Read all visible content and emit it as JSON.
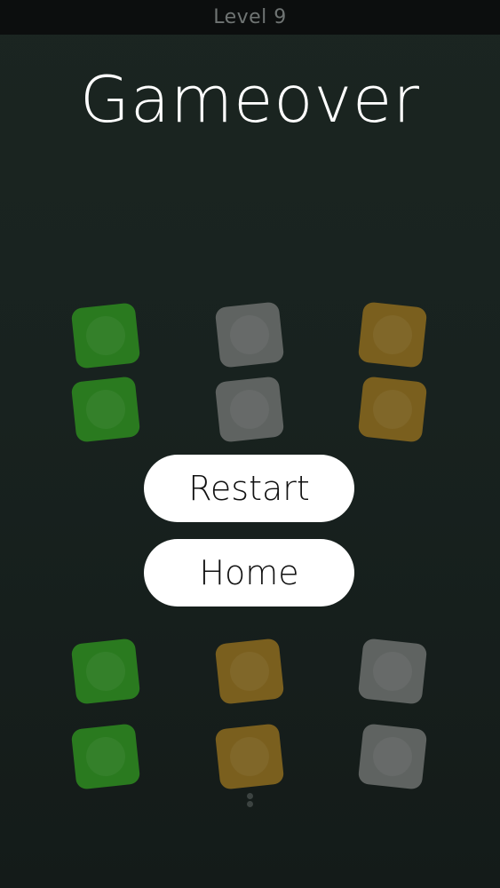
{
  "status": {
    "level_label": "Level 9"
  },
  "title": "Gameover",
  "board": {
    "tiles": [
      {
        "color": "green"
      },
      {
        "color": "gray"
      },
      {
        "color": "gold"
      },
      {
        "color": "green"
      },
      {
        "color": "gray"
      },
      {
        "color": "gold"
      },
      {
        "color": "green"
      },
      {
        "color": "gold"
      },
      {
        "color": "gray"
      },
      {
        "color": "green"
      },
      {
        "color": "gold"
      },
      {
        "color": "gray"
      }
    ]
  },
  "menu": {
    "restart_label": "Restart",
    "home_label": "Home"
  },
  "colors": {
    "green": "#2a7a1f",
    "gray": "#5f6361",
    "gold": "#7a5f1e",
    "button_bg": "#ffffff"
  }
}
